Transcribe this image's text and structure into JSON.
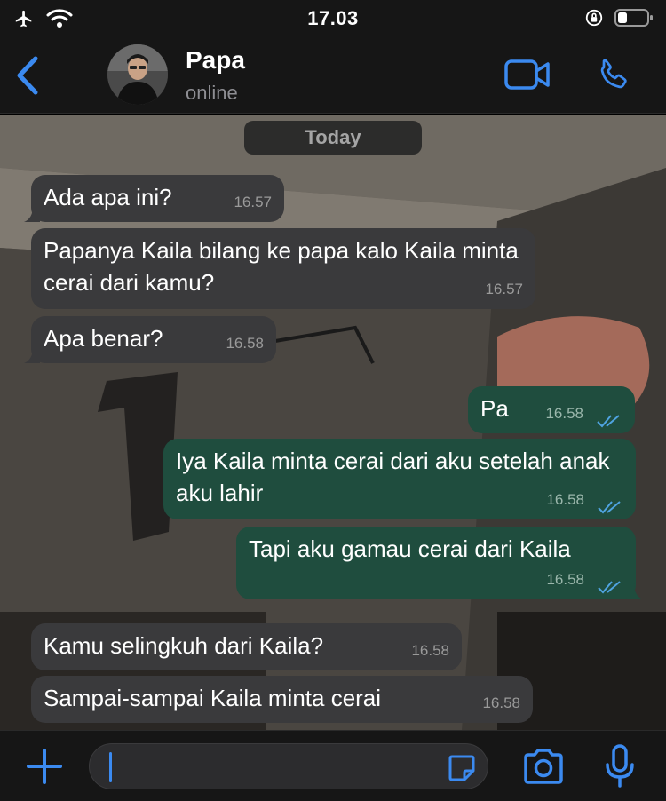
{
  "status_bar": {
    "time": "17.03",
    "icons": [
      "airplane-icon",
      "wifi-icon",
      "orientation-lock-icon",
      "battery-icon"
    ]
  },
  "header": {
    "back_icon": "chevron-left-icon",
    "contact_name": "Papa",
    "contact_status": "online",
    "video_icon": "video-call-icon",
    "call_icon": "phone-icon"
  },
  "chat": {
    "date_label": "Today",
    "messages": [
      {
        "direction": "in",
        "text": "Ada apa ini?",
        "time": "16.57"
      },
      {
        "direction": "in",
        "text": "Papanya Kaila bilang ke papa kalo Kaila minta cerai dari kamu?",
        "time": "16.57"
      },
      {
        "direction": "in",
        "text": "Apa benar?",
        "time": "16.58"
      },
      {
        "direction": "out",
        "text": "Pa",
        "time": "16.58",
        "status": "read"
      },
      {
        "direction": "out",
        "text": "Iya Kaila minta cerai dari aku setelah anak aku lahir",
        "time": "16.58",
        "status": "read"
      },
      {
        "direction": "out",
        "text": "Tapi aku gamau cerai dari Kaila",
        "time": "16.58",
        "status": "read"
      },
      {
        "direction": "in",
        "text": "Kamu selingkuh dari Kaila?",
        "time": "16.58"
      },
      {
        "direction": "in",
        "text": "Sampai-sampai Kaila minta cerai",
        "time": "16.58"
      }
    ]
  },
  "input_bar": {
    "plus_icon": "plus-icon",
    "text_value": "",
    "sticker_icon": "sticker-icon",
    "camera_icon": "camera-icon",
    "mic_icon": "microphone-icon"
  },
  "colors": {
    "accent": "#3b8af0",
    "incoming_bubble": "#3a3a3c",
    "outgoing_bubble": "#1f4d3e",
    "read_ticks": "#4fa3e0"
  }
}
